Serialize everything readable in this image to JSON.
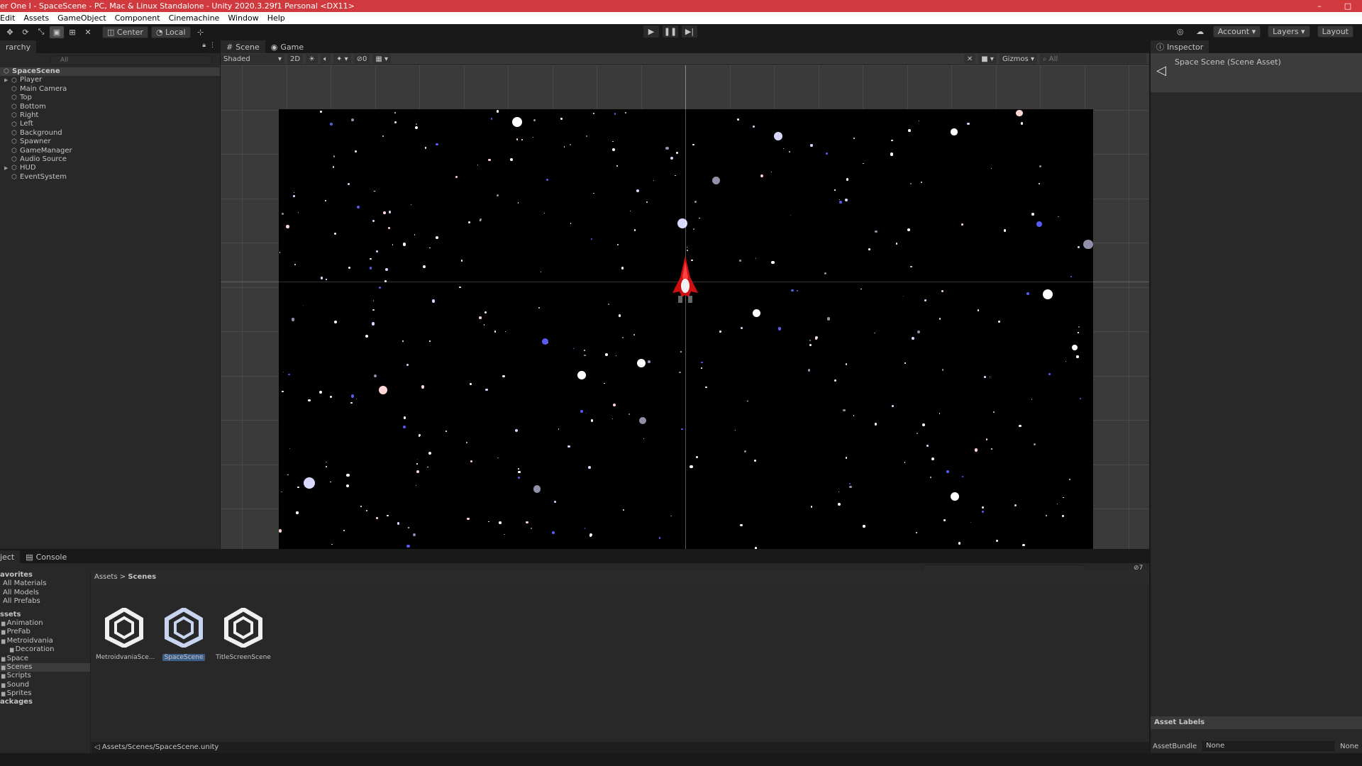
{
  "window": {
    "title": "er One I - SpaceScene - PC, Mac & Linux Standalone - Unity 2020.3.29f1 Personal <DX11>",
    "controls": [
      "–",
      "□"
    ]
  },
  "menu": [
    "Edit",
    "Assets",
    "GameObject",
    "Component",
    "Cinemachine",
    "Window",
    "Help"
  ],
  "toolbar": {
    "pivot_label": "Center",
    "space_label": "Local",
    "account_label": "Account",
    "layers_label": "Layers",
    "layout_label": "Layout"
  },
  "hierarchy": {
    "tab_label": "rarchy",
    "search_placeholder": "All",
    "root": "SpaceScene",
    "items": [
      {
        "label": "Player",
        "expandable": true
      },
      {
        "label": "Main Camera",
        "expandable": false
      },
      {
        "label": "Top",
        "expandable": false
      },
      {
        "label": "Bottom",
        "expandable": false
      },
      {
        "label": "Right",
        "expandable": false
      },
      {
        "label": "Left",
        "expandable": false
      },
      {
        "label": "Background",
        "expandable": false
      },
      {
        "label": "Spawner",
        "expandable": false
      },
      {
        "label": "GameManager",
        "expandable": false
      },
      {
        "label": "Audio Source",
        "expandable": false
      },
      {
        "label": "HUD",
        "expandable": true
      },
      {
        "label": "EventSystem",
        "expandable": false
      }
    ]
  },
  "scene": {
    "tabs": [
      "Scene",
      "Game"
    ],
    "draw_mode": "Shaded",
    "mode_2d": "2D",
    "hidden_count": "0",
    "gizmos_label": "Gizmos",
    "search_placeholder": "All"
  },
  "inspector": {
    "tab_label": "Inspector",
    "title": "Space Scene (Scene Asset)",
    "asset_labels": "Asset Labels",
    "assetbundle_label": "AssetBundle",
    "assetbundle_value": "None",
    "assetbundle_variant": "None"
  },
  "project": {
    "tabs": [
      "ject",
      "Console"
    ],
    "favorites_header": "avorites",
    "favorites": [
      "All Materials",
      "All Models",
      "All Prefabs"
    ],
    "assets_header": "ssets",
    "folders": [
      "Animation",
      "PreFab",
      "Metroidvania",
      "Decoration",
      "Space",
      "Scenes",
      "Scripts",
      "Sound",
      "Sprites"
    ],
    "packages_header": "ackages",
    "breadcrumb": [
      "Assets",
      "Scenes"
    ],
    "breadcrumb_sep": ">",
    "assets": [
      {
        "label": "MetroidvaniaSce...",
        "selected": false
      },
      {
        "label": "SpaceScene",
        "selected": true
      },
      {
        "label": "TitleScreenScene",
        "selected": false
      }
    ],
    "hidden_count": "7",
    "footer_path": "Assets/Scenes/SpaceScene.unity"
  },
  "colors": {
    "title_bar": "#d03a3e",
    "ship": "#d01010",
    "star_blue": "#5a5af0"
  }
}
